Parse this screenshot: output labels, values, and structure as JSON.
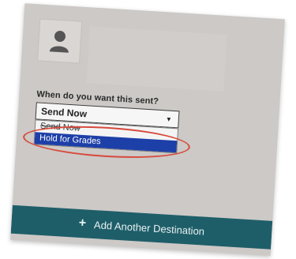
{
  "question_label": "When do you want this sent?",
  "send_select": {
    "selected": "Send Now",
    "options": [
      "Send Now",
      "Hold for Grades"
    ],
    "highlighted_option": "Hold for Grades"
  },
  "add_destination_button": {
    "icon": "+",
    "label": "Add Another Destination"
  },
  "colors": {
    "panel_bg": "#ccc9c6",
    "selected_option_bg": "#1d3fa8",
    "annotation_ring": "#d7493c",
    "button_bg": "#1e5e69"
  }
}
